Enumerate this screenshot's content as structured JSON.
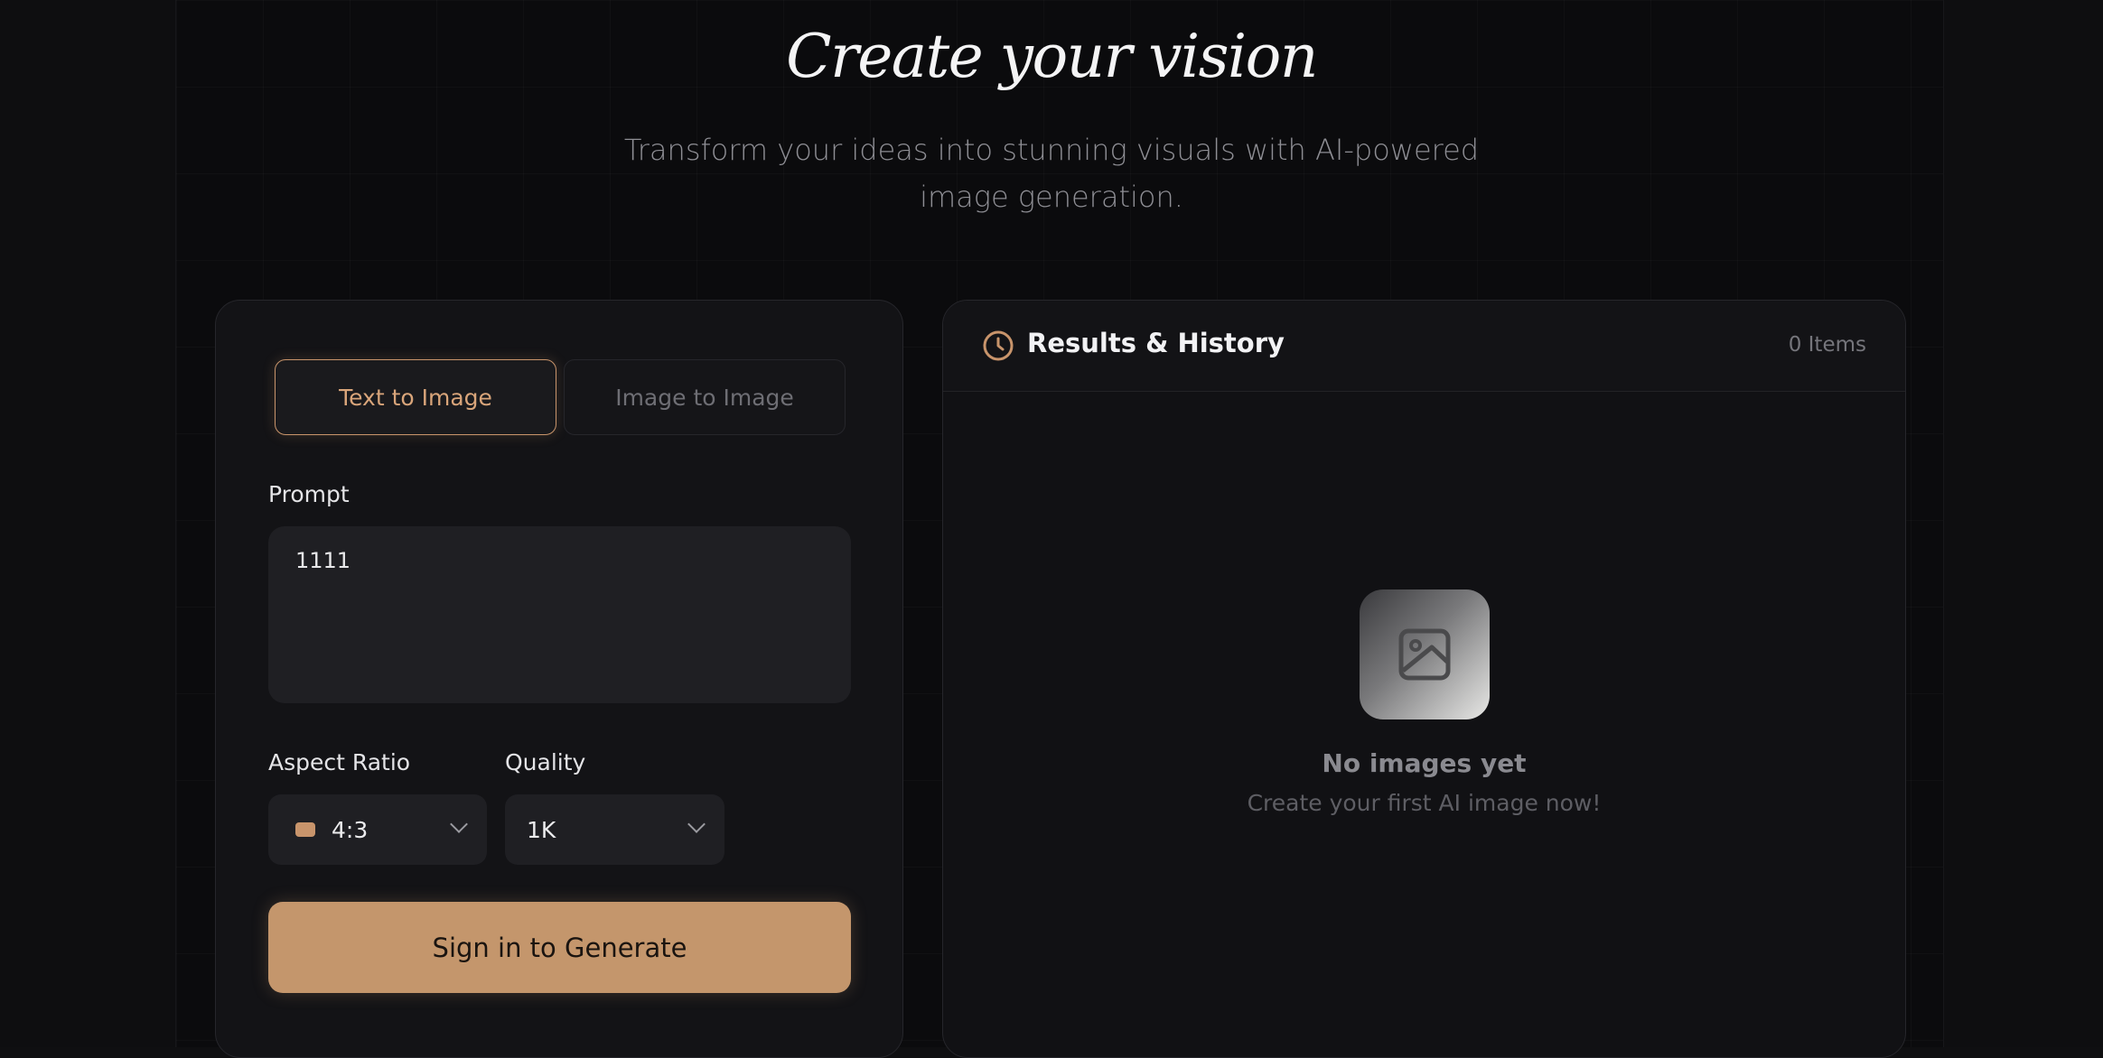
{
  "hero": {
    "title": "Create your vision",
    "subtitle": "Transform your ideas into stunning visuals with AI-powered image generation."
  },
  "generator": {
    "tabs": [
      {
        "label": "Text to Image",
        "active": true
      },
      {
        "label": "Image to Image",
        "active": false
      }
    ],
    "prompt_label": "Prompt",
    "prompt_value": "1111",
    "aspect_ratio_label": "Aspect Ratio",
    "aspect_ratio_value": "4:3",
    "quality_label": "Quality",
    "quality_value": "1K",
    "generate_label": "Sign in to Generate"
  },
  "results": {
    "title": "Results & History",
    "count": "0 Items",
    "empty_title": "No images yet",
    "empty_subtitle": "Create your first AI image now!"
  },
  "colors": {
    "accent": "#c4966c",
    "background": "#0b0b0d",
    "panel": "#131316"
  },
  "icons": {
    "history": "clock-icon",
    "placeholder": "image-icon",
    "dropdown": "chevron-down-icon"
  }
}
